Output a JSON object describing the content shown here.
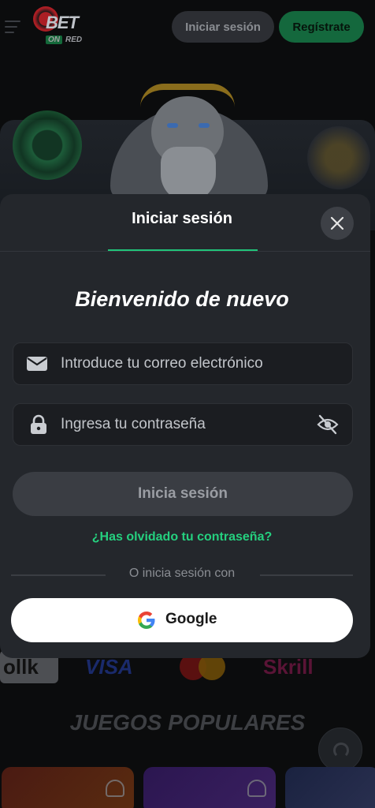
{
  "header": {
    "logo_bet": "BET",
    "logo_on": "ON",
    "logo_red": "RED",
    "login_label": "Iniciar sesión",
    "register_label": "Regístrate"
  },
  "background": {
    "payments": [
      "Skrill",
      "VISA",
      "Mastercard",
      "Skrill"
    ],
    "popular_games_title": "JUEGOS POPULARES"
  },
  "modal": {
    "title": "Iniciar sesión",
    "welcome": "Bienvenido de nuevo",
    "email_placeholder": "Introduce tu correo electrónico",
    "password_placeholder": "Ingresa tu contraseña",
    "submit_label": "Inicia sesión",
    "forgot_label": "¿Has olvidado tu contraseña?",
    "or_text": "O inicia sesión con",
    "google_label": "Google"
  },
  "colors": {
    "accent_green": "#25d07f",
    "register_green": "#14683d",
    "modal_bg": "#24272c",
    "page_bg": "#0b0c0d"
  },
  "icons": [
    "menu-icon",
    "close-icon",
    "envelope-icon",
    "lock-icon",
    "eye-off-icon",
    "google-icon",
    "headset-icon",
    "heart-icon"
  ]
}
